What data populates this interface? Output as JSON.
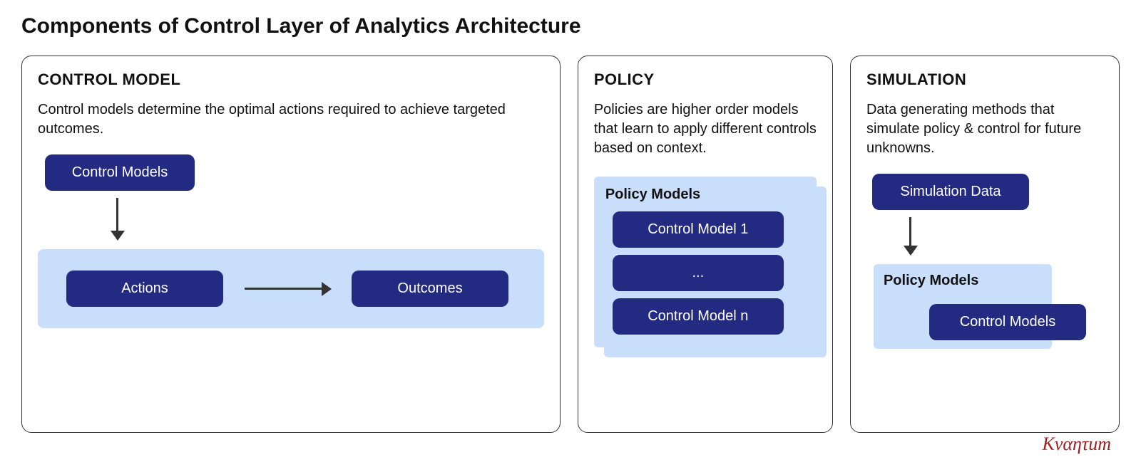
{
  "title": "Components of Control Layer of Analytics Architecture",
  "brand": "Κναητum",
  "panels": {
    "control": {
      "heading": "CONTROL MODEL",
      "desc": "Control models determine the optimal actions required to achieve targeted outcomes.",
      "box_models": "Control Models",
      "box_actions": "Actions",
      "box_outcomes": "Outcomes"
    },
    "policy": {
      "heading": "POLICY",
      "desc": "Policies are higher order models that learn to apply different controls based on context.",
      "container_title": "Policy Models",
      "items": [
        "Control Model 1",
        "...",
        "Control Model n"
      ]
    },
    "sim": {
      "heading": "SIMULATION",
      "desc": "Data generating methods that simulate policy & control for future unknowns.",
      "box_data": "Simulation Data",
      "container_title": "Policy Models",
      "box_models": "Control Models"
    }
  }
}
